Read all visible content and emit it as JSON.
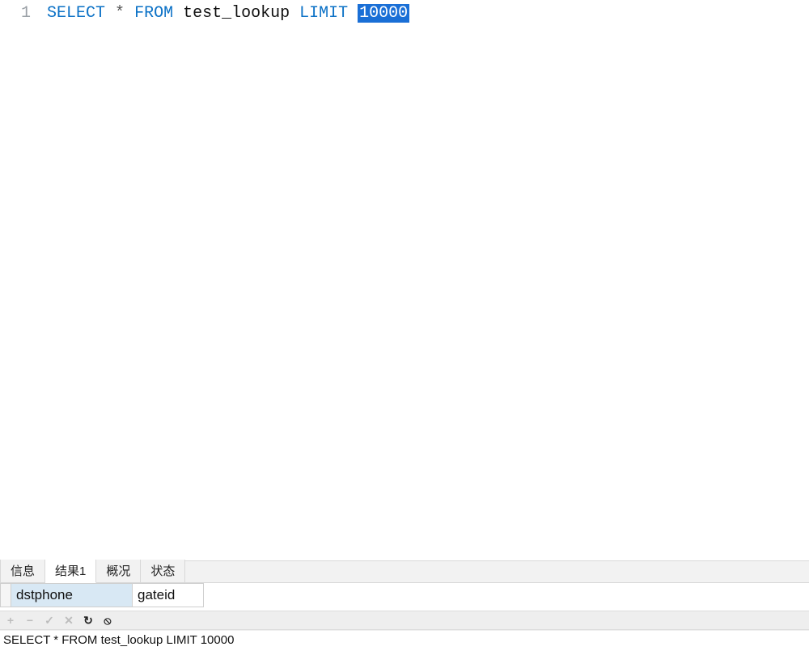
{
  "editor": {
    "line_number": "1",
    "sql": {
      "select": "SELECT",
      "star": "*",
      "from": "FROM",
      "table": "test_lookup",
      "limit": "LIMIT",
      "limit_value": "10000"
    }
  },
  "tabs": {
    "info": "信息",
    "result1": "结果1",
    "profile": "概况",
    "status": "状态"
  },
  "grid": {
    "columns": {
      "dstphone": "dstphone",
      "gateid": "gateid"
    }
  },
  "toolbar": {
    "add": "+",
    "remove": "−",
    "apply": "✓",
    "cancel": "✕",
    "refresh": "↻",
    "stop": "⦸"
  },
  "status_bar": {
    "query": "SELECT * FROM test_lookup LIMIT 10000"
  }
}
